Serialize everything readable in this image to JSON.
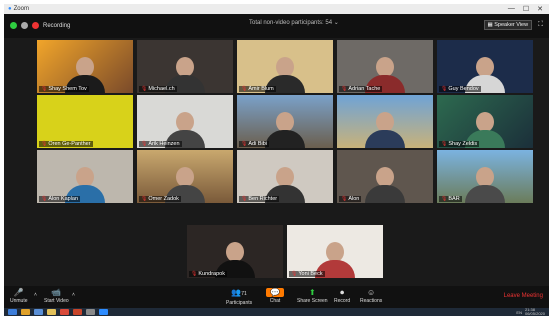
{
  "window": {
    "title": "Zoom"
  },
  "topbar": {
    "recording_label": "Recording",
    "participants_label": "Total non-video participants: 54",
    "speaker_view_label": "Speaker View"
  },
  "tiles": [
    {
      "name": "Shay Shem Tov"
    },
    {
      "name": "Michael.ch"
    },
    {
      "name": "Amir Blum"
    },
    {
      "name": "Adrian Tache"
    },
    {
      "name": "Guy Bendov"
    },
    {
      "name": "Oren Ge-Panther"
    },
    {
      "name": "Arik Heinzen"
    },
    {
      "name": "Adi Bibi"
    },
    {
      "name": "Shay Zeldis"
    },
    {
      "name": "Alon Kaplan"
    },
    {
      "name": "Omer Zadok"
    },
    {
      "name": "Ben Richter"
    },
    {
      "name": "Alon"
    },
    {
      "name": "BAR"
    },
    {
      "name": "Kundrapok"
    },
    {
      "name": "Yoni Beck"
    }
  ],
  "toolbar": {
    "unmute_label": "Unmute",
    "start_video_label": "Start Video",
    "participants_label": "Participants",
    "participants_count": "71",
    "chat_label": "Chat",
    "share_screen_label": "Share Screen",
    "record_label": "Record",
    "reactions_label": "Reactions",
    "leave_label": "Leave Meeting"
  },
  "taskbar": {
    "lang": "EN",
    "time": "21:38",
    "date": "06/05/2020"
  }
}
